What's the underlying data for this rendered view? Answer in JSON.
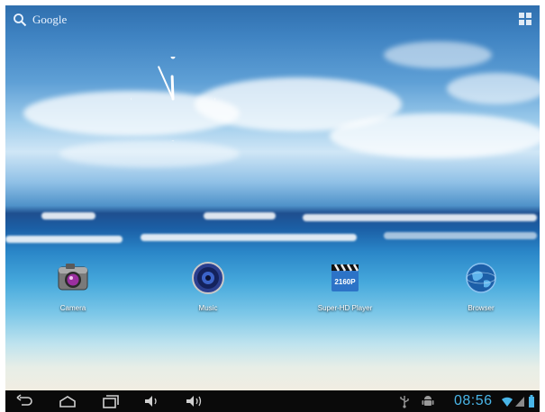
{
  "search": {
    "label": "Google",
    "icon": "search-icon"
  },
  "apps_button": {
    "icon": "all-apps-grid-icon"
  },
  "clock": {
    "hour": 11,
    "minute": 56
  },
  "apps": [
    {
      "label": "Camera",
      "icon": "camera-icon"
    },
    {
      "label": "Music",
      "icon": "speaker-music-icon"
    },
    {
      "label": "Super-HD Player",
      "icon": "clapperboard-2160p-icon",
      "badge": "2160P"
    },
    {
      "label": "Browser",
      "icon": "globe-icon"
    }
  ],
  "navbar": {
    "buttons": [
      "back-icon",
      "home-icon",
      "recent-apps-icon",
      "volume-down-icon",
      "volume-up-icon"
    ],
    "status": {
      "time": "08:56",
      "icons": [
        "usb-icon",
        "android-debug-icon",
        "wifi-icon",
        "signal-icon",
        "battery-icon"
      ]
    }
  },
  "colors": {
    "time": "#49b5e7",
    "navbar": "#0a0a0a"
  }
}
